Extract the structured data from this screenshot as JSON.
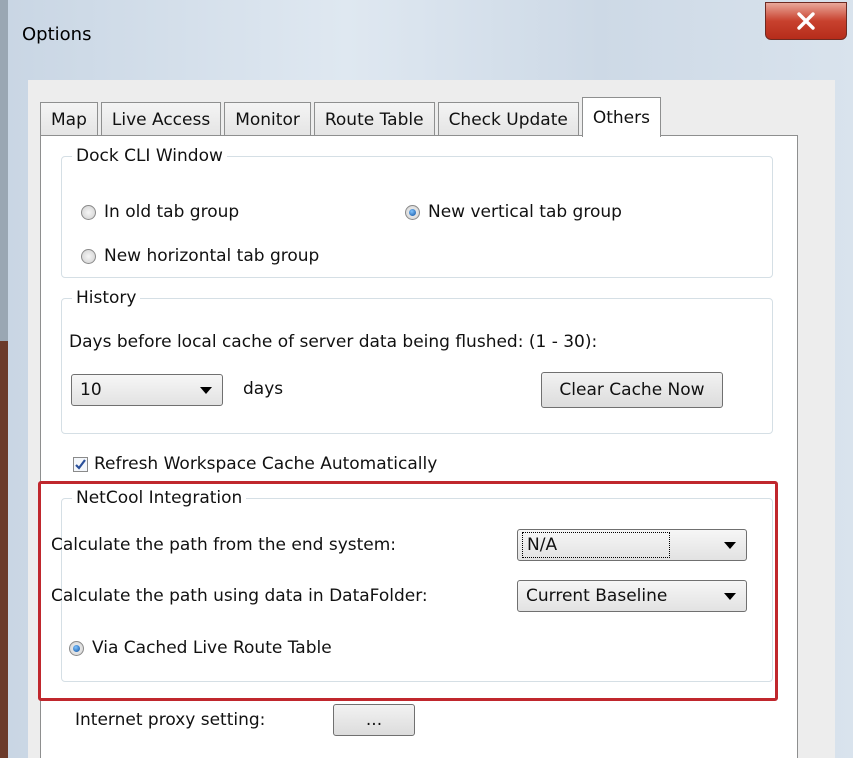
{
  "window": {
    "title": "Options"
  },
  "tabs": [
    {
      "label": "Map",
      "active": false
    },
    {
      "label": "Live Access",
      "active": false
    },
    {
      "label": "Monitor",
      "active": false
    },
    {
      "label": "Route Table",
      "active": false
    },
    {
      "label": "Check Update",
      "active": false
    },
    {
      "label": "Others",
      "active": true
    }
  ],
  "dock_cli": {
    "legend": "Dock CLI Window",
    "options": [
      {
        "label": "In old tab group",
        "selected": false
      },
      {
        "label": "New vertical tab group",
        "selected": true
      },
      {
        "label": "New horizontal tab group",
        "selected": false
      }
    ]
  },
  "history": {
    "legend": "History",
    "description": "Days before local cache of server data being flushed: (1 - 30):",
    "days_value": "10",
    "days_unit": "days",
    "clear_button": "Clear Cache Now"
  },
  "refresh_cache": {
    "label": "Refresh Workspace Cache Automatically",
    "checked": true
  },
  "netcool": {
    "legend": "NetCool Integration",
    "end_system_label": "Calculate the path from the end system:",
    "end_system_value": "N/A",
    "datafolder_label": "Calculate the path using data in DataFolder:",
    "datafolder_value": "Current Baseline",
    "route_option": {
      "label": "Via Cached Live Route Table",
      "selected": true
    }
  },
  "proxy": {
    "label": "Internet proxy setting:",
    "button": "..."
  },
  "colors": {
    "highlight": "#c0272d",
    "close_button": "#c8412e",
    "radio_selected": "#0d4f9e"
  },
  "icons": {
    "close": "close-icon",
    "dropdown": "chevron-down-icon",
    "check": "checkmark-icon"
  }
}
